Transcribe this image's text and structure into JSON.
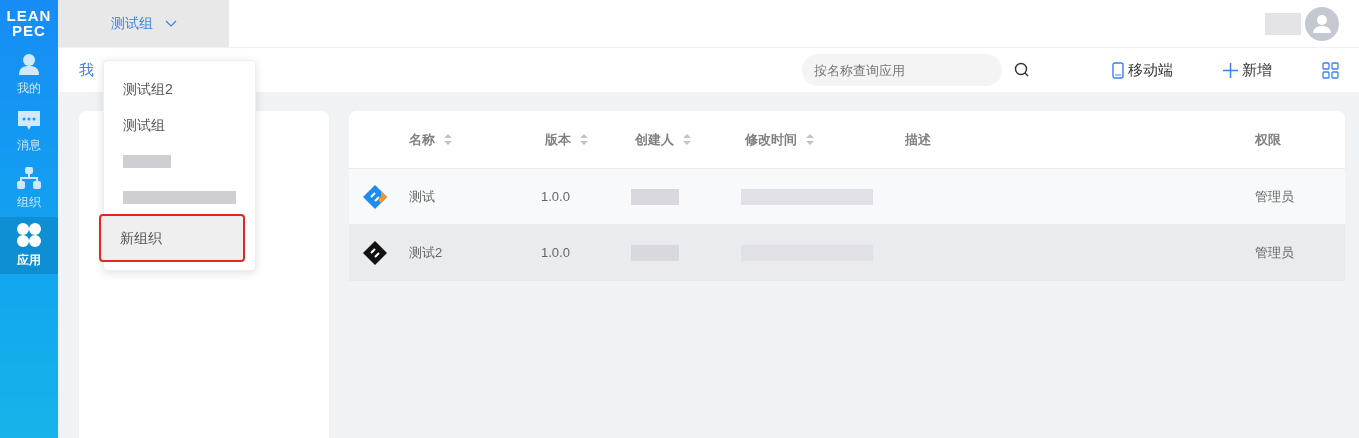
{
  "logo": {
    "line_1": "LEAN",
    "line_2": "PEC"
  },
  "sidebar": {
    "items": [
      {
        "label": "我的",
        "selected": false
      },
      {
        "label": "消息",
        "selected": false
      },
      {
        "label": "组织",
        "selected": false
      },
      {
        "label": "应用",
        "selected": true
      }
    ]
  },
  "group_selector": {
    "label": "测试组"
  },
  "dropdown": {
    "items": [
      {
        "kind": "text",
        "label": "测试组2",
        "selected": false
      },
      {
        "kind": "text",
        "label": "测试组",
        "selected": false
      },
      {
        "kind": "redacted",
        "selected": false
      },
      {
        "kind": "redacted",
        "selected": false
      },
      {
        "kind": "text",
        "label": "新组织",
        "selected": true
      }
    ]
  },
  "tab": {
    "label": "我"
  },
  "search": {
    "placeholder": "按名称查询应用"
  },
  "toolbar": {
    "mobile": "移动端",
    "add": "新增"
  },
  "table": {
    "columns": [
      {
        "label": "名称",
        "sortable": true
      },
      {
        "label": "版本",
        "sortable": true
      },
      {
        "label": "创建人",
        "sortable": true
      },
      {
        "label": "修改时间",
        "sortable": true
      },
      {
        "label": "描述",
        "sortable": false
      },
      {
        "label": "权限",
        "sortable": false
      }
    ],
    "rows": [
      {
        "color": "#1e8bf0",
        "name": "测试",
        "version": "1.0.0",
        "permission": "管理员",
        "selected": false
      },
      {
        "color": "#111111",
        "name": "测试2",
        "version": "1.0.0",
        "permission": "管理员",
        "selected": true
      }
    ]
  }
}
